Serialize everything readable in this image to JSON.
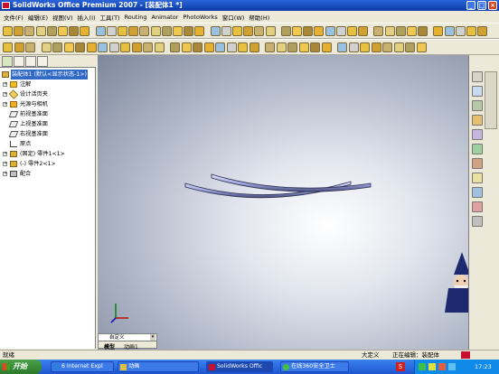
{
  "titlebar": {
    "title": "SolidWorks Office Premium 2007 - [装配体1 *]"
  },
  "menu": {
    "items": [
      "文件(F)",
      "编辑(E)",
      "视图(V)",
      "插入(I)",
      "工具(T)",
      "Routing",
      "Animator",
      "PhotoWorks",
      "窗口(W)",
      "帮助(H)"
    ]
  },
  "tree": {
    "nodes": [
      {
        "label": "装配体1 (默认<显示状态-1>)",
        "selected": true
      },
      {
        "label": "注解"
      },
      {
        "label": "设计活页夹"
      },
      {
        "label": "光源与相机"
      },
      {
        "label": "前视基准面"
      },
      {
        "label": "上视基准面"
      },
      {
        "label": "右视基准面"
      },
      {
        "label": "原点"
      },
      {
        "label": "(固定) 零件1<1>"
      },
      {
        "label": "(-) 零件2<1>"
      },
      {
        "label": "配合"
      }
    ]
  },
  "bottom_tabs": {
    "dropdown": "自定义",
    "tab_model": "模型",
    "tab_animation": "动画1"
  },
  "status": {
    "left": "就绪",
    "units": "大定义",
    "editing": "正在编辑：装配体"
  },
  "taskbar": {
    "start": "开始",
    "tasks": [
      "6 Internet Expl",
      "动画",
      "SolidWorks Offic",
      "在线360安全卫士"
    ],
    "clock": "17:23"
  },
  "colors": {
    "titlebar": "#0a3aa8",
    "viewport_center": "#ffffff",
    "viewport_edge": "#7e889c",
    "part": "#a3aae0",
    "taskbar": "#1d55d0",
    "start": "#2c7a2a"
  }
}
